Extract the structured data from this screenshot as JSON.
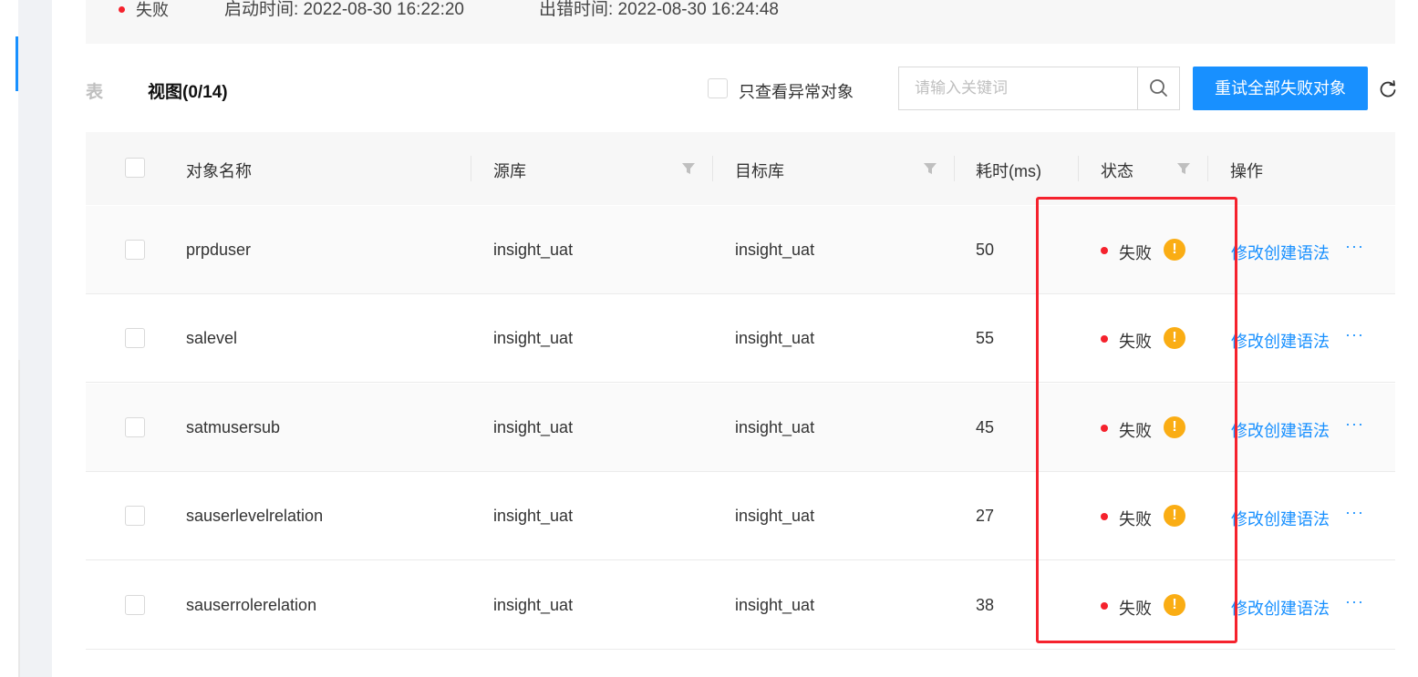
{
  "status_bar": {
    "status": "失败",
    "start_time": "启动时间: 2022-08-30 16:22:20",
    "error_time": "出错时间: 2022-08-30 16:24:48"
  },
  "tabs": {
    "previous": "表",
    "active": "视图(0/14)"
  },
  "filter": {
    "abnormal_only_label": "只查看异常对象",
    "search_placeholder": "请输入关键词",
    "search_icon": "search-icon",
    "retry_button": "重试全部失败对象",
    "refresh_icon": "refresh-icon"
  },
  "table": {
    "headers": {
      "name": "对象名称",
      "source": "源库",
      "target": "目标库",
      "elapsed": "耗时(ms)",
      "status": "状态",
      "actions": "操作"
    },
    "rows": [
      {
        "name": "prpduser",
        "source": "insight_uat",
        "target": "insight_uat",
        "elapsed": "50",
        "status": "失败",
        "action": "修改创建语法",
        "more": "···"
      },
      {
        "name": "salevel",
        "source": "insight_uat",
        "target": "insight_uat",
        "elapsed": "55",
        "status": "失败",
        "action": "修改创建语法",
        "more": "···"
      },
      {
        "name": "satmusersub",
        "source": "insight_uat",
        "target": "insight_uat",
        "elapsed": "45",
        "status": "失败",
        "action": "修改创建语法",
        "more": "···"
      },
      {
        "name": "sauserlevelrelation",
        "source": "insight_uat",
        "target": "insight_uat",
        "elapsed": "27",
        "status": "失败",
        "action": "修改创建语法",
        "more": "···"
      },
      {
        "name": "sauserrolerelation",
        "source": "insight_uat",
        "target": "insight_uat",
        "elapsed": "38",
        "status": "失败",
        "action": "修改创建语法",
        "more": "···"
      }
    ]
  },
  "colors": {
    "accent": "#1890ff",
    "error": "#f5222d",
    "warning": "#faad14"
  }
}
